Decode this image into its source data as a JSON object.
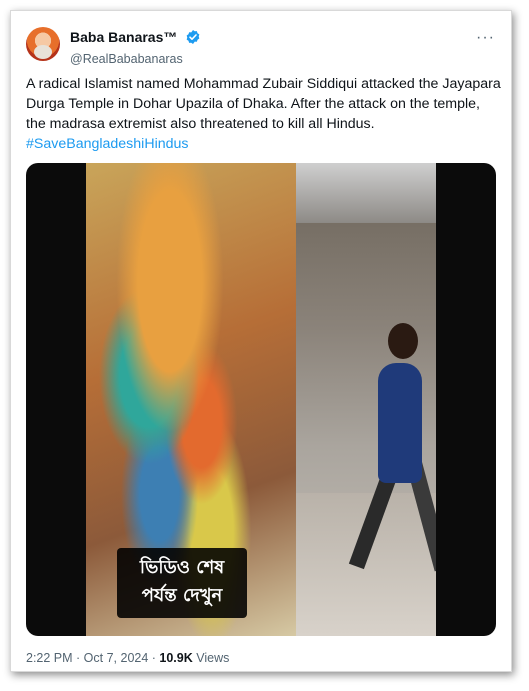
{
  "author": {
    "display_name": "Baba Banaras™",
    "handle": "@RealBababanaras",
    "verified_icon": "verified-badge-icon",
    "accent": "#1d9bf0"
  },
  "tweet": {
    "text": "A radical Islamist named Mohammad Zubair Siddiqui attacked the Jayapara Durga Temple in Dohar Upazila of Dhaka. After the attack on the temple, the madrasa extremist also threatened to kill all Hindus.",
    "hashtag": "#SaveBangladeshiHindus"
  },
  "media": {
    "caption_line1": "ভিডিও শেষ",
    "caption_line2": "পর্যন্ত দেখুন"
  },
  "meta": {
    "time": "2:22 PM",
    "separator1": " · ",
    "date": "Oct 7, 2024",
    "separator2": " · ",
    "views_count": "10.9K",
    "views_label": " Views"
  },
  "more_menu": "···"
}
